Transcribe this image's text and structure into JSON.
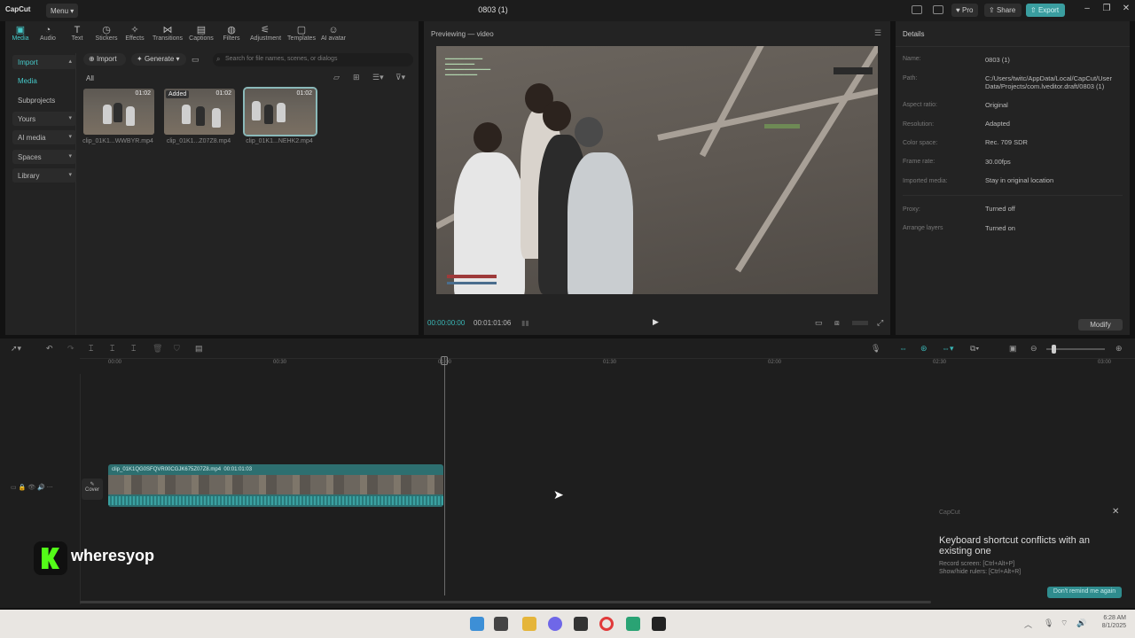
{
  "app": {
    "logo": "CapCut",
    "menu_label": "Menu",
    "project_title": "0803 (1)",
    "pro_label": "Pro",
    "share_label": "Share",
    "export_label": "Export"
  },
  "toolbar": [
    {
      "label": "Media",
      "icon": "media-icon"
    },
    {
      "label": "Audio",
      "icon": "audio-icon"
    },
    {
      "label": "Text",
      "icon": "text-icon"
    },
    {
      "label": "Stickers",
      "icon": "stickers-icon"
    },
    {
      "label": "Effects",
      "icon": "effects-icon"
    },
    {
      "label": "Transitions",
      "icon": "transitions-icon"
    },
    {
      "label": "Captions",
      "icon": "captions-icon"
    },
    {
      "label": "Filters",
      "icon": "filters-icon"
    },
    {
      "label": "Adjustment",
      "icon": "adjustment-icon"
    },
    {
      "label": "Templates",
      "icon": "templates-icon"
    },
    {
      "label": "AI avatar",
      "icon": "ai-avatar-icon"
    }
  ],
  "sidenav": {
    "import": "Import",
    "media": "Media",
    "subprojects": "Subprojects",
    "yours": "Yours",
    "ai_media": "AI media",
    "spaces": "Spaces",
    "library": "Library"
  },
  "media": {
    "import_btn": "Import",
    "generate_btn": "Generate",
    "search_placeholder": "Search for file names, scenes, or dialogs",
    "filter_label": "All",
    "clips": [
      {
        "name": "clip_01K1...WWBYR.mp4",
        "duration": "01:02",
        "added": ""
      },
      {
        "name": "clip_01K1...Z07Z8.mp4",
        "duration": "01:02",
        "added": "Added"
      },
      {
        "name": "clip_01K1...NEHK2.mp4",
        "duration": "01:02",
        "added": ""
      }
    ]
  },
  "preview": {
    "title": "Previewing — video",
    "current_time": "00:00:00:00",
    "total_time": "00:01:01:06"
  },
  "details": {
    "title": "Details",
    "rows": [
      {
        "k": "Name:",
        "v": "0803 (1)"
      },
      {
        "k": "Path:",
        "v": "C:/Users/twitc/AppData/Local/CapCut/User Data/Projects/com.lveditor.draft/0803 (1)"
      },
      {
        "k": "Aspect ratio:",
        "v": "Original"
      },
      {
        "k": "Resolution:",
        "v": "Adapted"
      },
      {
        "k": "Color space:",
        "v": "Rec. 709 SDR"
      },
      {
        "k": "Frame rate:",
        "v": "30.00fps"
      },
      {
        "k": "Imported media:",
        "v": "Stay in original location"
      },
      {
        "k": "Proxy:",
        "v": "Turned off"
      },
      {
        "k": "Arrange layers",
        "v": "Turned on"
      }
    ],
    "modify_btn": "Modify"
  },
  "timeline": {
    "ruler": [
      "00:00",
      "00:30",
      "01:00",
      "01:30",
      "02:00",
      "02:30",
      "03:00"
    ],
    "clip_label": "clip_01K1QG0SFQVR00CGJK675Z07Z8.mp4",
    "clip_duration": "00:01:01:03",
    "cover_label": "Cover"
  },
  "notification": {
    "brand": "CapCut",
    "title": "Keyboard shortcut conflicts with an existing one",
    "line1": "Record screen: [Ctrl+Alt+P]",
    "line2": "Show/hide rulers: [Ctrl+Alt+R]",
    "button": "Don't remind me again"
  },
  "watermark": {
    "name": "wheresyop"
  },
  "taskbar": {
    "time": "6:28 AM",
    "date": "8/1/2025"
  }
}
